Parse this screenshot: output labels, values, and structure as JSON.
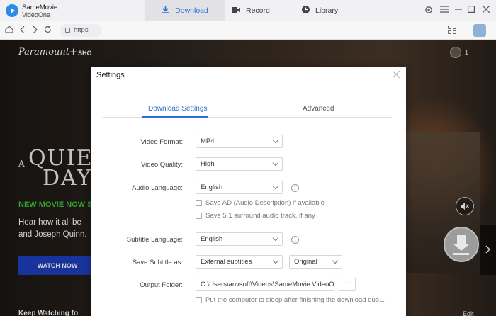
{
  "app": {
    "name_line1": "SameMovie",
    "name_line2": "VideoOne"
  },
  "nav_tabs": [
    {
      "label": "Download",
      "active": true
    },
    {
      "label": "Record",
      "active": false
    },
    {
      "label": "Library",
      "active": false
    }
  ],
  "browser": {
    "url_text": "https"
  },
  "webpage": {
    "logo": "Paramount+",
    "nav_shows": "SHO",
    "avatar_count": "1",
    "title_a": "A",
    "title_line1": "QUIET",
    "title_line2": "DAY",
    "tagline": "NEW MOVIE NOW S",
    "description": "Hear how it all be and Joseph Quinn.",
    "watch_now": "WATCH NOW",
    "keep_watching": "Keep Watching fo",
    "edit": "Edit"
  },
  "settings": {
    "title": "Settings",
    "tabs": {
      "download": "Download Settings",
      "advanced": "Advanced"
    },
    "video_format": {
      "label": "Video Format:",
      "value": "MP4"
    },
    "video_quality": {
      "label": "Video Quality:",
      "value": "High"
    },
    "audio_language": {
      "label": "Audio Language:",
      "value": "English"
    },
    "save_ad": {
      "label": "Save AD (Audio Description) if available",
      "checked": false
    },
    "save_51": {
      "label": "Save 5.1 surround audio track, if any",
      "checked": false
    },
    "subtitle_language": {
      "label": "Subtitle Language:",
      "value": "English"
    },
    "save_subtitle": {
      "label": "Save Subtitle as:",
      "value": "External subtitles",
      "value2": "Original"
    },
    "output_folder": {
      "label": "Output Folder:",
      "value": "C:\\Users\\anvsoft\\Videos\\SameMovie VideoO",
      "browse": "···"
    },
    "sleep": {
      "label": "Put the computer to sleep after finishing the download quo...",
      "checked": false
    }
  },
  "colors": {
    "accent": "#2f6fd6",
    "watch_now": "#1f3fbf",
    "tagline": "#43c43a"
  }
}
